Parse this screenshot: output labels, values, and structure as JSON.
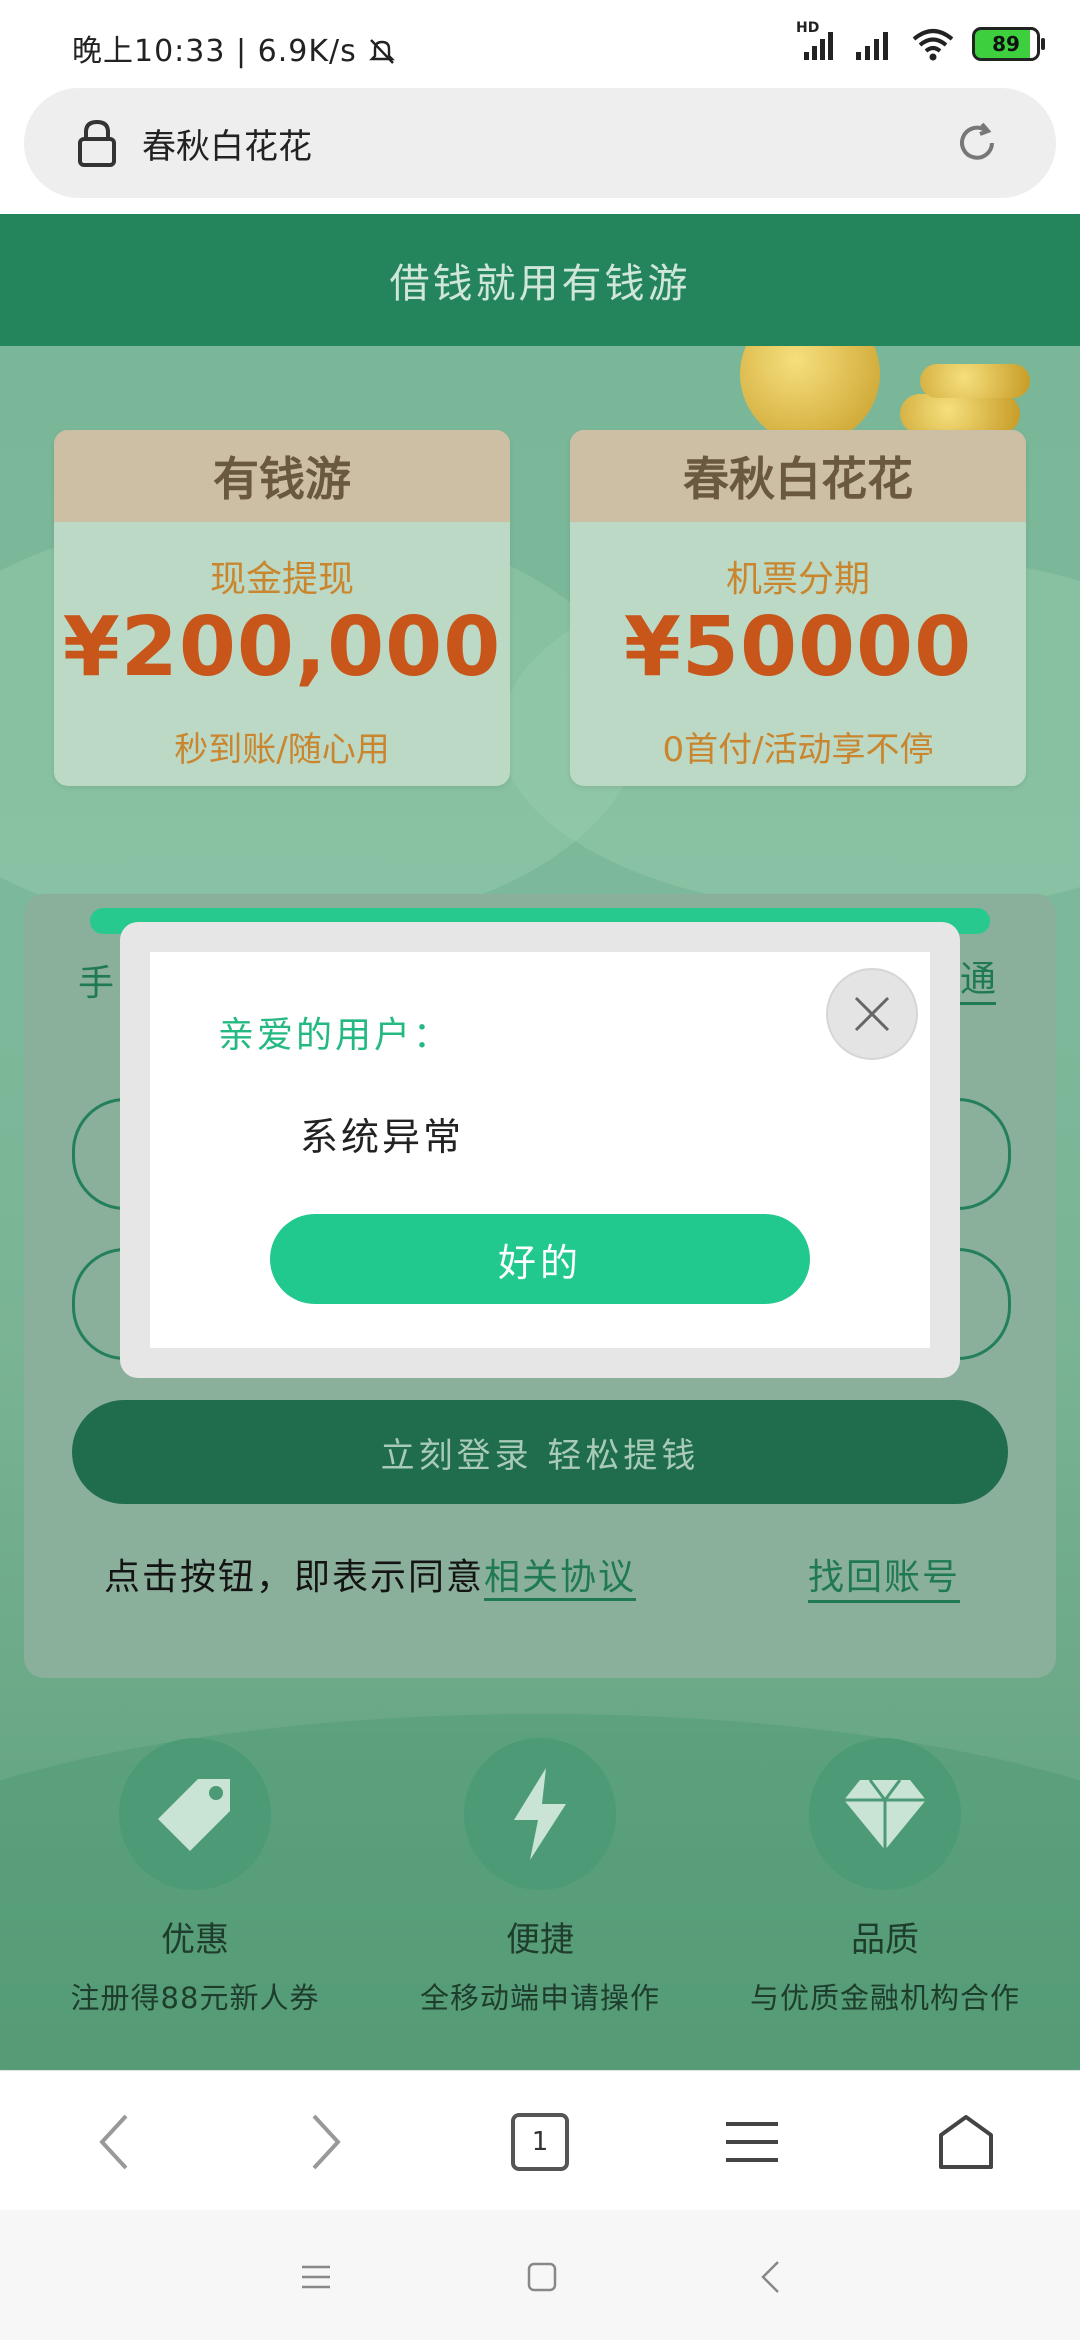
{
  "status_bar": {
    "time": "晚上10:33",
    "speed": "6.9K/s",
    "hd_label": "HD",
    "battery": "89"
  },
  "address_bar": {
    "site_title": "春秋白花花"
  },
  "page": {
    "header_title": "借钱就用有钱游",
    "cards": [
      {
        "tab": "有钱游",
        "subtitle": "现金提现",
        "amount": "¥200,000",
        "note": "秒到账/随心用"
      },
      {
        "tab": "春秋白花花",
        "subtitle": "机票分期",
        "amount": "¥50000",
        "note": "0首付/活动享不停"
      }
    ],
    "login": {
      "left_partial": "手",
      "right_partial_link": "通",
      "submit_label": "立刻登录 轻松提钱",
      "agree_prefix": "点击按钮，即表示同意",
      "agreement_link": "相关协议",
      "recover_link": "找回账号"
    },
    "features": [
      {
        "icon": "tag-icon",
        "title": "优惠",
        "desc": "注册得88元新人券"
      },
      {
        "icon": "lightning-icon",
        "title": "便捷",
        "desc": "全移动端申请操作"
      },
      {
        "icon": "diamond-icon",
        "title": "品质",
        "desc": "与优质金融机构合作"
      }
    ]
  },
  "dialog": {
    "greeting": "亲爱的用户：",
    "message": "系统异常",
    "ok_label": "好的"
  },
  "toolbar": {
    "tab_count": "1"
  },
  "colors": {
    "header_green": "#24855c",
    "accent_green": "#22c98f",
    "promo_orange": "#c8561b"
  }
}
